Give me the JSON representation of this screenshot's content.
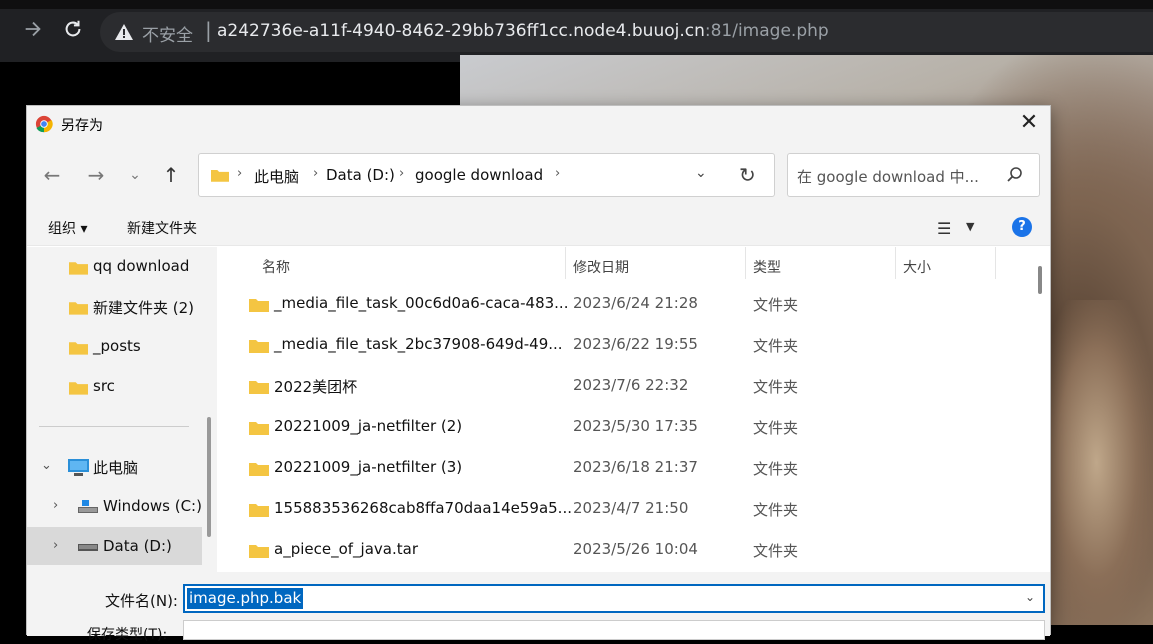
{
  "browser": {
    "security_label": "不安全",
    "url_host": "a242736e-a11f-4940-8462-29bb736ff1cc.node4.buuoj.cn",
    "url_rest": ":81/image.php",
    "icons": [
      "back-arrow-icon",
      "forward-arrow-icon",
      "reload-icon",
      "warning-icon"
    ]
  },
  "dialog": {
    "title": "另存为",
    "breadcrumbs": [
      "此电脑",
      "Data (D:)",
      "google download"
    ],
    "search_placeholder": "在 google download 中...",
    "commands": {
      "organize": "组织 ▾",
      "new_folder": "新建文件夹"
    },
    "nav_items": [
      {
        "label": "qq download"
      },
      {
        "label": "新建文件夹 (2)"
      },
      {
        "label": "_posts"
      },
      {
        "label": "src"
      },
      {
        "label": "此电脑"
      },
      {
        "label": "Windows (C:)"
      },
      {
        "label": "Data (D:)",
        "selected": true
      }
    ],
    "columns": {
      "name": "名称",
      "date": "修改日期",
      "type": "类型",
      "size": "大小"
    },
    "files": [
      {
        "name": "_media_file_task_00c6d0a6-caca-483...",
        "date": "2023/6/24 21:28",
        "type": "文件夹"
      },
      {
        "name": "_media_file_task_2bc37908-649d-49...",
        "date": "2023/6/22 19:55",
        "type": "文件夹"
      },
      {
        "name": "2022美团杯",
        "date": "2023/7/6 22:32",
        "type": "文件夹"
      },
      {
        "name": "20221009_ja-netfilter (2)",
        "date": "2023/5/30 17:35",
        "type": "文件夹"
      },
      {
        "name": "20221009_ja-netfilter (3)",
        "date": "2023/6/18 21:37",
        "type": "文件夹"
      },
      {
        "name": "155883536268cab8ffa70daa14e59a5...",
        "date": "2023/4/7 21:50",
        "type": "文件夹"
      },
      {
        "name": "a_piece_of_java.tar",
        "date": "2023/5/26 10:04",
        "type": "文件夹"
      }
    ],
    "filename_label": "文件名(N):",
    "filename_value": "image.php.bak",
    "filetype_label": "保存类型(T):"
  },
  "colors": {
    "accent": "#0067c0",
    "folder": "#f4c542",
    "browser_bg": "#202124"
  }
}
